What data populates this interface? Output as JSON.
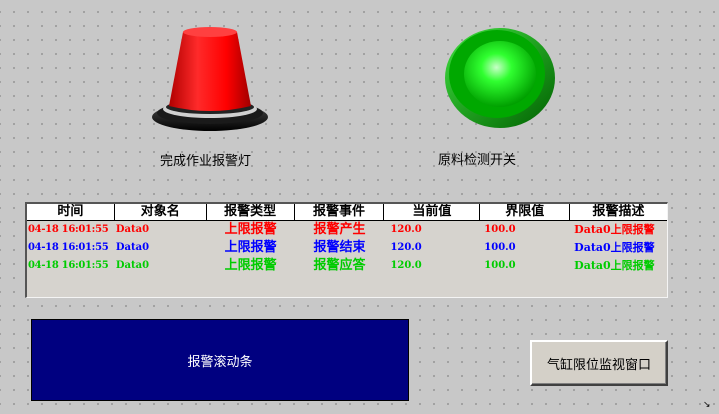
{
  "alarm_lamp": {
    "label": "完成作业报警灯",
    "color": "#ff0000"
  },
  "detect_switch": {
    "label": "原料检测开关",
    "color": "#00d000"
  },
  "alarm_table": {
    "columns": [
      "时间",
      "对象名",
      "报警类型",
      "报警事件",
      "当前值",
      "界限值",
      "报警描述"
    ],
    "rows": [
      {
        "color": "#ff0000",
        "cells": [
          "04-18 16:01:55",
          "Data0",
          "上限报警",
          "报警产生",
          "120.0",
          "100.0",
          "Data0上限报警"
        ]
      },
      {
        "color": "#0000ff",
        "cells": [
          "04-18 16:01:55",
          "Data0",
          "上限报警",
          "报警结束",
          "120.0",
          "100.0",
          "Data0上限报警"
        ]
      },
      {
        "color": "#00cc00",
        "cells": [
          "04-18 16:01:55",
          "Data0",
          "上限报警",
          "报警应答",
          "120.0",
          "100.0",
          "Data0上限报警"
        ]
      }
    ]
  },
  "scroll_bar": {
    "text": "报警滚动条",
    "background": "#000080"
  },
  "cylinder_button": {
    "label": "气缸限位监视窗口"
  }
}
